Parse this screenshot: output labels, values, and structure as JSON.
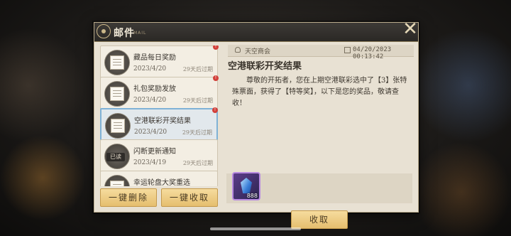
{
  "window": {
    "title": "邮件",
    "subtitle": "MAIL",
    "close_icon": "close-icon"
  },
  "mails": [
    {
      "subject": "藏品每日奖励",
      "date": "2023/4/20",
      "expire": "29天后过期",
      "unread": true,
      "read_badge": ""
    },
    {
      "subject": "礼包奖励发放",
      "date": "2023/4/20",
      "expire": "29天后过期",
      "unread": true,
      "read_badge": ""
    },
    {
      "subject": "空港联彩开奖结果",
      "date": "2023/4/20",
      "expire": "29天后过期",
      "unread": true,
      "selected": true,
      "read_badge": ""
    },
    {
      "subject": "闪断更新通知",
      "date": "2023/4/19",
      "expire": "29天后过期",
      "unread": false,
      "read_badge": "已读"
    },
    {
      "subject": "幸运轮盘大奖重选",
      "date": "",
      "expire": "",
      "unread": false,
      "read_badge": ""
    }
  ],
  "buttons": {
    "delete_all": "一键删除",
    "claim_all": "一键收取",
    "claim": "收取"
  },
  "detail": {
    "sender": "天空商会",
    "send_time": "04/20/2023 00:13:42",
    "title": "空港联彩开奖结果",
    "body": "尊敬的开拓者，您在上期空港联彩选中了【3】张特殊票面，获得了【特等奖】，以下是您的奖品，敬请查收！",
    "attachment": {
      "icon": "crystal-icon",
      "count": "888"
    }
  },
  "colors": {
    "accent_gold": "#e5be6e",
    "selected_border": "#7fb2d6",
    "unread_dot": "#d2403a"
  }
}
